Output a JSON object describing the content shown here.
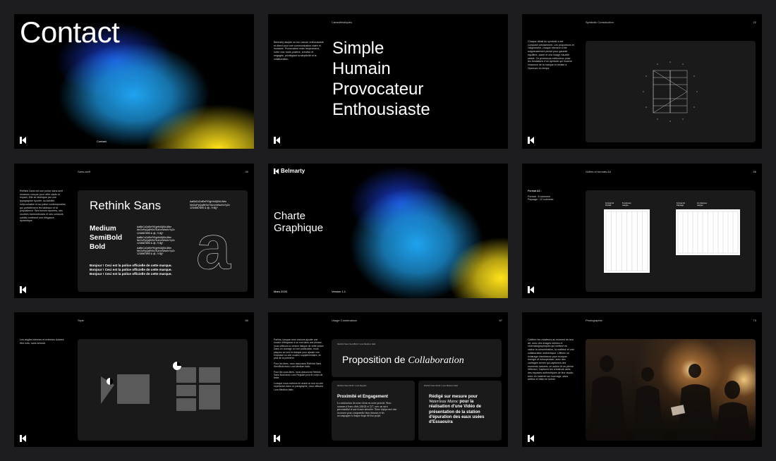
{
  "slides": {
    "contact": {
      "title": "Contact",
      "footer": "Contact"
    },
    "characteristics": {
      "header": "Caractéristiques",
      "body": "Belmarty adopte un ton casual, enthousiaste et direct pour une communication claire et humaine. Provocateur mais respectueux, notre voix reste positive, créative et engagée, privilégiant la simplicité et la collaboration.",
      "words": [
        "Simple",
        "Humain",
        "Provocateur",
        "Enthousiaste"
      ]
    },
    "symbolic": {
      "header": "Symbolic Construction",
      "number": "22",
      "body": "Chaque détail du symbole a été composé précisément. Les proportions et l'alignement, chaque élément a été soigneusement pensé pour garantir équilibre, clarté et une image visuelle stable. Ce processus méticuleux pose les fondations d'un symbole qui incarne l'essence de la marque et résiste à l'épreuve du temps."
    },
    "typography": {
      "header": "Sans-serif",
      "number": "40",
      "body": "Rethink Sans est une police sans-serif moderne conçue pour offrir clarté et impact. Elle se distingue par une typographie épurée, sa lisibilité irréprochable et sa police contemporaine, qui parfaitement les tableaux et la polyvalence. Ses formes épurées, ses courbes harmonieuses et ses contours subtils confèrent une élégance dynamique.",
      "font_name": "Rethink Sans",
      "weights": [
        "Medium",
        "SemiBold",
        "Bold"
      ],
      "glyphs_line1": "AaBbCcDdEeFfGgHhIiJjKkLlMm",
      "glyphs_line2": "NnOoPpQqRrSsTtUuVvWwXxYyZz",
      "glyphs_line3": "1234567890 & @.,?!;$()*",
      "sample": "Bonjour ! Ceci est la police officielle de cette marque.",
      "specimen": "a"
    },
    "cover": {
      "brand": "Belmarty",
      "title_line1": "Charte",
      "title_line2": "Graphique",
      "date": "Mars 2025",
      "version": "Version 1.1"
    },
    "grids": {
      "header": "Grilles et formats A4",
      "number": "56",
      "body_title": "Format A4 :",
      "body_lines": [
        "Portrait : 8 colonnes",
        "Paysage : 12 colonnes"
      ],
      "portrait_label": "Format A4\nPortrait",
      "portrait_sub": "8 colonnes\nmarges",
      "landscape_label": "Format A4\nPaysage",
      "landscape_sub": "12 colonnes\nmarges"
    },
    "style": {
      "header": "Style",
      "number": "60",
      "body": "Les angles internes et externes doivent être nets, sans arrondi."
    },
    "combination": {
      "header": "Usage Combinaison",
      "number": "67",
      "body1": "Parfois, lorsque nous voulons ajouter une touche d'élégance à un mot dans une phrase, nous utilisons la version italique de cette police. Dans un ouvrage ou une publication, nous plaçons un mot en italique pour ajouter une emphase ou une couleur supplémentaire, en plus de la première.",
      "body2": "Pour les titres, nous associons Rethink Sans SemiBold avec Lora Medium Italic.",
      "body3": "Pour les sous-titres, nous associons Rethink Sans Bold avec Lora Regular pour le corps de texte.",
      "body4": "Lorsque nous mettons en avant un mot ou une expression dans un paragraphe, nous utilisons Lora Medium Italic.",
      "panel1_tag": "Rethink Sans SemiBold / Lora Medium Italic",
      "headline_main": "Proposition de ",
      "headline_italic": "Collaboration",
      "panel2_tag": "Rethink Sans Bold / Lora Regular",
      "panel2_title": "Proximité et Engagement",
      "panel2_body": "La satisfaction de notre client est notre priorité. Nous sommes à leurs côtés 24h/24 et 7j/7, avec un suivi personnalisé et une écoute attentive. Notre équipe met tout en œuvre pour comprendre leurs besoins et les accompagner à chaque étape de leur projet.",
      "panel3_tag": "Rethink Sans Bold / Lora Medium Italic",
      "panel3_pre": "Rédigé sur mesure pour",
      "panel3_italic": "Waterleau Maroc",
      "panel3_post": "pour la réalisation d'une Vidéo de présentation de la station d'épuration des eaux usées d'Essaouira"
    },
    "photography": {
      "header": "Photographie",
      "number": "73",
      "body": "Célébre les créateurs au moment de leur art, avec des images intimes et cinématographiques qui mettent en valeur la concentration, la maîtrise et une collaboration authentique. Utilisez un éclairage d'ambiance pour évoquer énergie et introspection, avec des cadrages serrés qui capturent des moments naturels, en action et en pleine réflexion. Capturez les créateurs dans des espaces authentiques de leur studio, avec du matériel sur tournage, sans artifice et mise en scène."
    },
    "colors": {
      "blue": "#1fa3f0",
      "yellow": "#ffe21a",
      "deep_blue": "#1b3cd4",
      "panel": "#1a1a1a"
    }
  }
}
